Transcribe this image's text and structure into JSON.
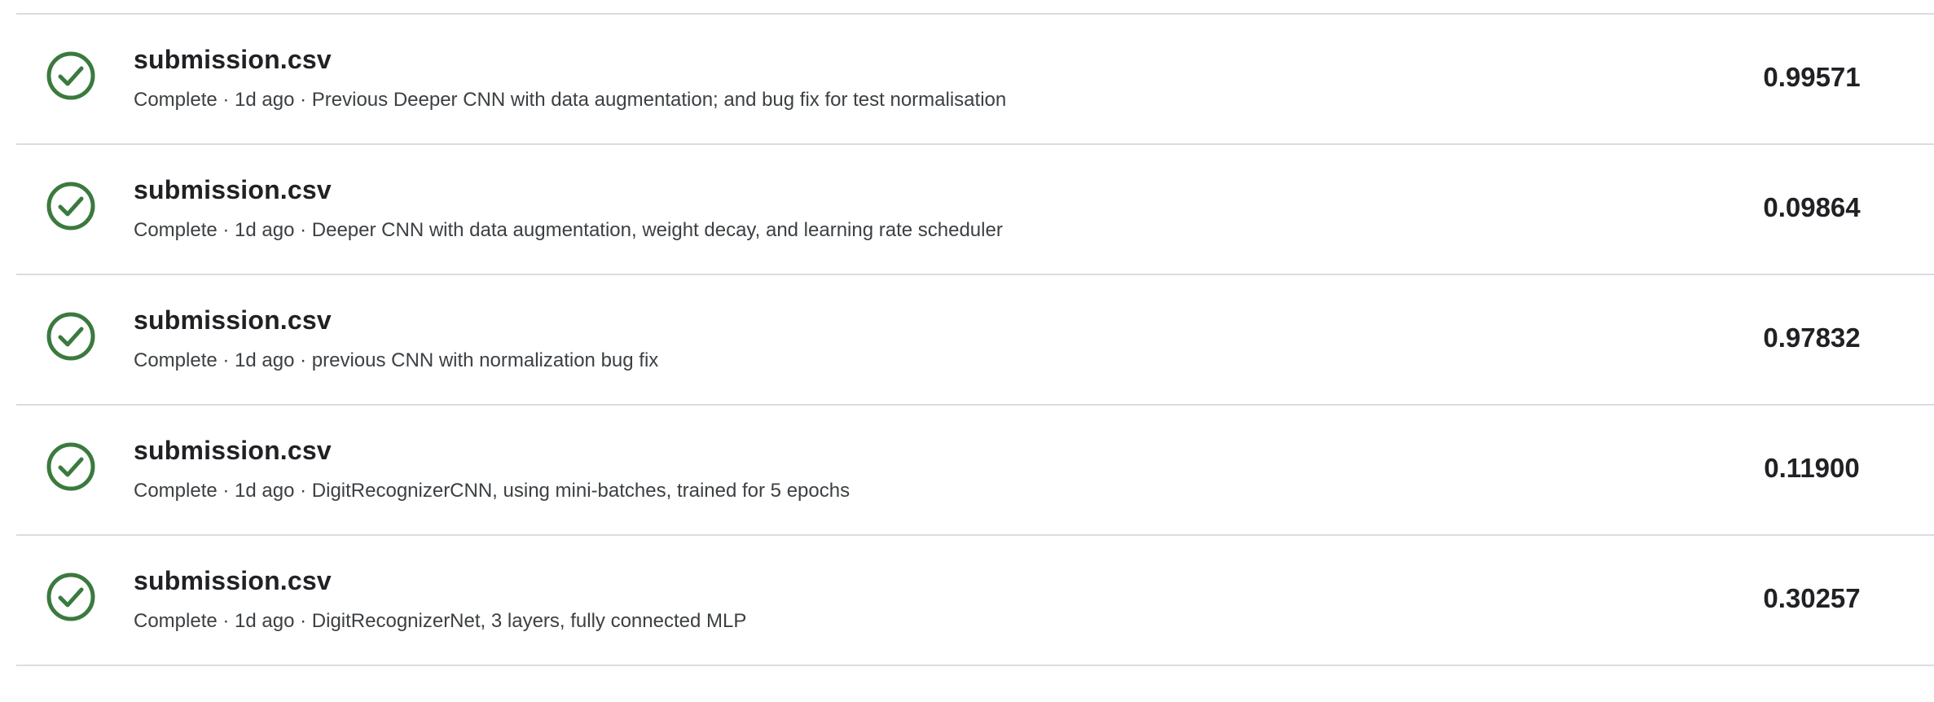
{
  "colors": {
    "success": "#3b7a3e",
    "divider": "#dadce0",
    "text_primary": "#202124",
    "text_secondary": "#3c4043"
  },
  "submissions": [
    {
      "icon": "check-circle-icon",
      "filename": "submission.csv",
      "status": "Complete",
      "age": "1d ago",
      "description": "Previous Deeper CNN with data augmentation; and bug fix for test normalisation",
      "meta": "Complete · 1d ago · Previous Deeper CNN with data augmentation; and bug fix for test normalisation",
      "score": "0.99571"
    },
    {
      "icon": "check-circle-icon",
      "filename": "submission.csv",
      "status": "Complete",
      "age": "1d ago",
      "description": "Deeper CNN with data augmentation, weight decay, and learning rate scheduler",
      "meta": "Complete · 1d ago · Deeper CNN with data augmentation, weight decay, and learning rate scheduler",
      "score": "0.09864"
    },
    {
      "icon": "check-circle-icon",
      "filename": "submission.csv",
      "status": "Complete",
      "age": "1d ago",
      "description": "previous CNN with normalization bug fix",
      "meta": "Complete · 1d ago · previous CNN with normalization bug fix",
      "score": "0.97832"
    },
    {
      "icon": "check-circle-icon",
      "filename": "submission.csv",
      "status": "Complete",
      "age": "1d ago",
      "description": "DigitRecognizerCNN, using mini-batches, trained for 5 epochs",
      "meta": "Complete · 1d ago · DigitRecognizerCNN, using mini-batches, trained for 5 epochs",
      "score": "0.11900"
    },
    {
      "icon": "check-circle-icon",
      "filename": "submission.csv",
      "status": "Complete",
      "age": "1d ago",
      "description": "DigitRecognizerNet, 3 layers, fully connected MLP",
      "meta": "Complete · 1d ago · DigitRecognizerNet, 3 layers, fully connected MLP",
      "score": "0.30257"
    }
  ]
}
